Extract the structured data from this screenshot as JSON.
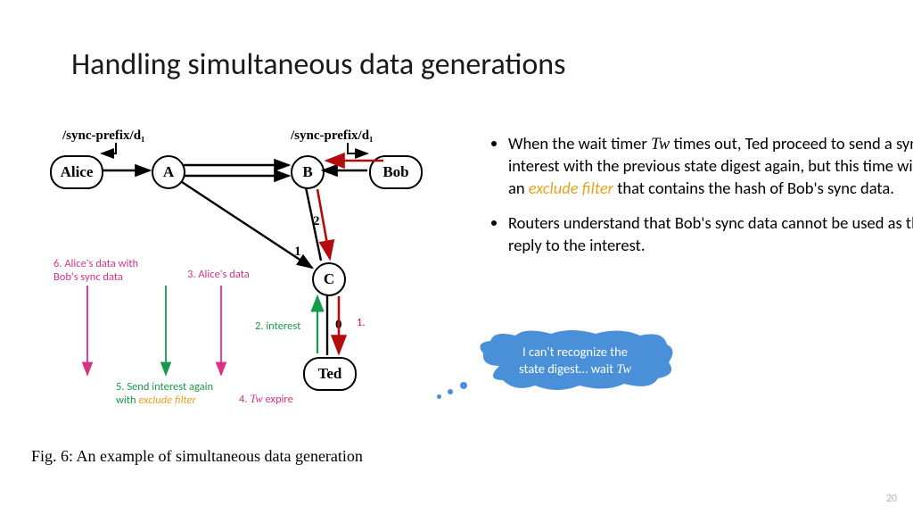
{
  "title": "Handling simultaneous data generations",
  "page_number": "20",
  "fig_caption": "Fig. 6: An example of simultaneous data generation",
  "bullets": [
    {
      "pre": "When the wait timer ",
      "tw": "Tw",
      "mid": " times out, Ted proceed to send a sync interest with the previous state digest again, but this time with an ",
      "hl": "exclude filter",
      "post": " that contains the hash of Bob's sync data."
    },
    {
      "text": "Routers understand that Bob's sync data cannot be used as the reply to the interest."
    }
  ],
  "cloud_line1": "I can't recognize the",
  "cloud_line2_pre": "state digest… wait ",
  "cloud_tw": "Tw",
  "nodes": {
    "alice": "Alice",
    "a": "A",
    "b": "B",
    "bob": "Bob",
    "c": "C",
    "ted": "Ted"
  },
  "edge_labels": {
    "bc_2": "2",
    "ac_1": "1",
    "ct_0": "0"
  },
  "prefix_left": "/sync-prefix/d₁",
  "prefix_right": "/sync-prefix/d₁",
  "ann": {
    "step1": "1.",
    "step2": "2. interest",
    "step3": "3. Alice's data",
    "step4_pre": "4. ",
    "step4_tw": "Tw",
    "step4_post": " expire",
    "step5_pre": "5. Send interest again",
    "step5_post": "with ",
    "step5_hl": "exclude filter",
    "step6_l1": "6. Alice's data with",
    "step6_l2": "Bob's sync data"
  }
}
